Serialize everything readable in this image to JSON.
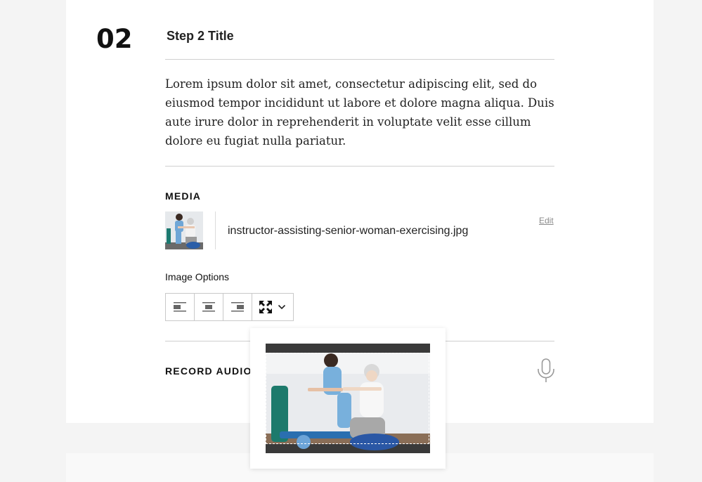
{
  "step": {
    "number": "02",
    "title": "Step 2 Title",
    "body": "Lorem ipsum dolor sit amet, consectetur adipiscing elit, sed do eiusmod tempor incididunt ut labore et dolore magna aliqua. Duis aute irure dolor in reprehenderit in voluptate velit esse cillum dolore eu fugiat nulla pariatur."
  },
  "media": {
    "heading": "MEDIA",
    "file_name": "instructor-assisting-senior-woman-exercising.jpg",
    "edit_label": "Edit",
    "thumbnail_icon": "photo-thumbnail"
  },
  "image_options": {
    "label": "Image Options",
    "buttons": [
      {
        "name": "align-left-icon"
      },
      {
        "name": "align-center-icon"
      },
      {
        "name": "align-right-icon"
      },
      {
        "name": "fullscreen-icon",
        "has_dropdown": true
      }
    ]
  },
  "record_audio": {
    "heading": "RECORD AUDIO",
    "icon": "microphone-icon"
  },
  "colors": {
    "page_bg": "#f4f4f4",
    "card_bg": "#ffffff",
    "rule": "#cfcfcf",
    "muted": "#8a8a8a"
  }
}
